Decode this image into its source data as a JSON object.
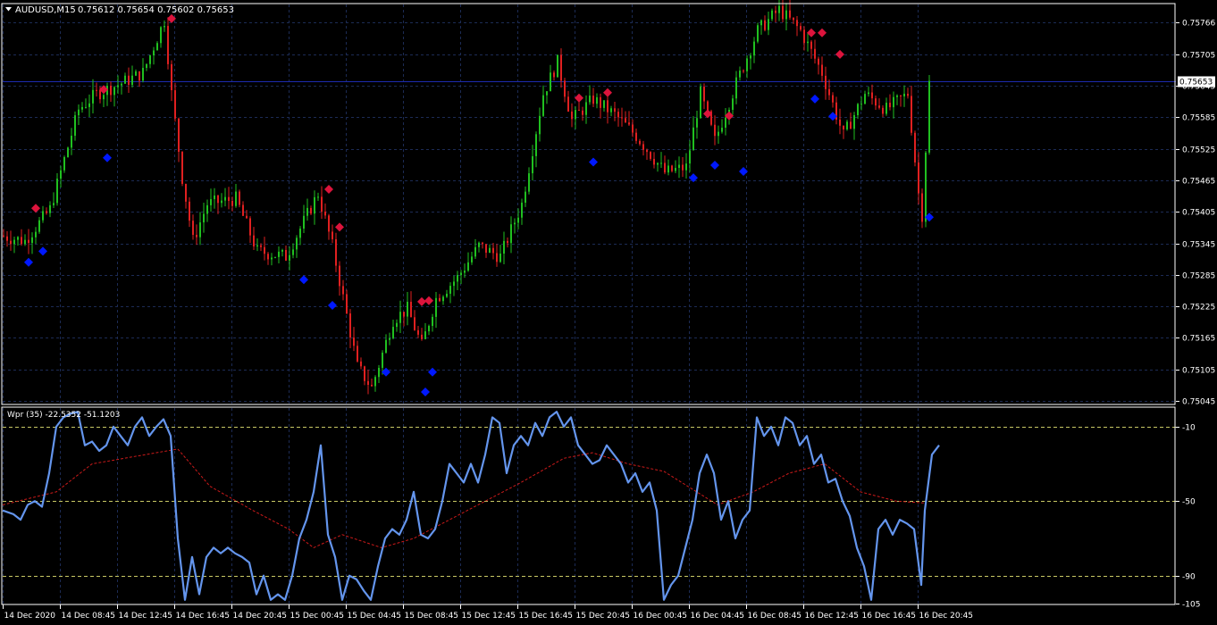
{
  "window": {
    "title": "AUDUSD,M15",
    "ohlc": "0.75612 0.75654 0.75602 0.75653",
    "menu_icon": "triangle-down-icon"
  },
  "colors": {
    "background": "#000000",
    "grid": "#1c2b55",
    "frame": "#ffffff",
    "bull": "#20c020",
    "bear": "#e02020",
    "sell_signal": "#dc143c",
    "buy_signal": "#0018ff",
    "wpr_line": "#6495ed",
    "wpr_signal": "#cc1a1a",
    "level_line": "#c8c864",
    "bid_line": "#1c2bb0"
  },
  "chart_data": [
    {
      "type": "line",
      "title": "AUDUSD,M15",
      "ylim": [
        0.7504,
        0.758
      ],
      "y_ticks": [
        0.75766,
        0.75705,
        0.75645,
        0.75585,
        0.75525,
        0.75465,
        0.75405,
        0.75345,
        0.75285,
        0.75225,
        0.75165,
        0.75105,
        0.75045
      ],
      "y_tick_labels": [
        "0.75766",
        "0.75705",
        "0.75645",
        "0.75585",
        "0.75525",
        "0.75465",
        "0.75405",
        "0.75345",
        "0.75285",
        "0.75225",
        "0.75165",
        "0.75105",
        "0.75045"
      ],
      "current_price": 0.75653,
      "current_price_label": "0.75653",
      "x_labels": [
        "14 Dec 2020",
        "14 Dec 08:45",
        "14 Dec 12:45",
        "14 Dec 16:45",
        "14 Dec 20:45",
        "15 Dec 00:45",
        "15 Dec 04:45",
        "15 Dec 08:45",
        "15 Dec 12:45",
        "15 Dec 16:45",
        "15 Dec 20:45",
        "16 Dec 00:45",
        "16 Dec 04:45",
        "16 Dec 08:45",
        "16 Dec 12:45",
        "16 Dec 16:45",
        "16 Dec 20:45"
      ],
      "x_label_index": [
        0,
        16,
        32,
        48,
        64,
        80,
        96,
        112,
        128,
        144,
        160,
        176,
        192,
        208,
        224,
        240,
        256
      ],
      "n_bars": 260,
      "close_path": [
        [
          0,
          0.7536
        ],
        [
          7,
          0.7535
        ],
        [
          14,
          0.7541
        ],
        [
          22,
          0.756
        ],
        [
          27,
          0.7563
        ],
        [
          34,
          0.7565
        ],
        [
          40,
          0.7567
        ],
        [
          46,
          0.7577
        ],
        [
          48,
          0.7563
        ],
        [
          51,
          0.7547
        ],
        [
          54,
          0.7535
        ],
        [
          58,
          0.7542
        ],
        [
          66,
          0.7543
        ],
        [
          72,
          0.7533
        ],
        [
          80,
          0.7532
        ],
        [
          89,
          0.7544
        ],
        [
          93,
          0.7534
        ],
        [
          100,
          0.7511
        ],
        [
          104,
          0.7507
        ],
        [
          110,
          0.752
        ],
        [
          114,
          0.7522
        ],
        [
          118,
          0.7515
        ],
        [
          122,
          0.7524
        ],
        [
          128,
          0.7528
        ],
        [
          134,
          0.7534
        ],
        [
          140,
          0.7532
        ],
        [
          146,
          0.7542
        ],
        [
          152,
          0.7563
        ],
        [
          156,
          0.7569
        ],
        [
          160,
          0.7558
        ],
        [
          166,
          0.7562
        ],
        [
          172,
          0.7559
        ],
        [
          178,
          0.7555
        ],
        [
          186,
          0.7548
        ],
        [
          192,
          0.7549
        ],
        [
          196,
          0.7563
        ],
        [
          200,
          0.7554
        ],
        [
          206,
          0.7565
        ],
        [
          212,
          0.7575
        ],
        [
          218,
          0.7579
        ],
        [
          224,
          0.7575
        ],
        [
          230,
          0.7567
        ],
        [
          236,
          0.7555
        ],
        [
          242,
          0.7563
        ],
        [
          248,
          0.756
        ],
        [
          254,
          0.7563
        ],
        [
          257,
          0.7544
        ],
        [
          258,
          0.754
        ],
        [
          260,
          0.7565
        ]
      ],
      "sell_signals": [
        {
          "i": 9,
          "price": 0.75412
        },
        {
          "i": 28,
          "price": 0.75638
        },
        {
          "i": 47,
          "price": 0.75773
        },
        {
          "i": 91,
          "price": 0.75448
        },
        {
          "i": 94,
          "price": 0.75376
        },
        {
          "i": 117,
          "price": 0.75234
        },
        {
          "i": 119,
          "price": 0.75236
        },
        {
          "i": 161,
          "price": 0.75622
        },
        {
          "i": 169,
          "price": 0.75632
        },
        {
          "i": 197,
          "price": 0.75592
        },
        {
          "i": 203,
          "price": 0.75588
        },
        {
          "i": 226,
          "price": 0.75746
        },
        {
          "i": 229,
          "price": 0.75746
        },
        {
          "i": 234,
          "price": 0.75705
        }
      ],
      "buy_signals": [
        {
          "i": 7,
          "price": 0.75309
        },
        {
          "i": 11,
          "price": 0.7533
        },
        {
          "i": 29,
          "price": 0.75508
        },
        {
          "i": 84,
          "price": 0.75276
        },
        {
          "i": 92,
          "price": 0.75227
        },
        {
          "i": 107,
          "price": 0.751
        },
        {
          "i": 118,
          "price": 0.75062
        },
        {
          "i": 120,
          "price": 0.751
        },
        {
          "i": 165,
          "price": 0.755
        },
        {
          "i": 193,
          "price": 0.7547
        },
        {
          "i": 199,
          "price": 0.75494
        },
        {
          "i": 207,
          "price": 0.75482
        },
        {
          "i": 227,
          "price": 0.7562
        },
        {
          "i": 232,
          "price": 0.75587
        },
        {
          "i": 259,
          "price": 0.75395
        }
      ]
    },
    {
      "type": "line",
      "title": "Wpr (35) -22.5352 -51.1203",
      "ylim": [
        -105,
        0
      ],
      "y_ticks": [
        -10,
        -50,
        -90,
        -105
      ],
      "y_tick_labels": [
        "-10",
        "-50",
        "-90",
        "-105"
      ],
      "levels": [
        -10,
        -50,
        -90
      ],
      "series": [
        {
          "role": "wpr",
          "points": [
            [
              0,
              -55
            ],
            [
              3,
              -57
            ],
            [
              5,
              -60
            ],
            [
              7,
              -52
            ],
            [
              9,
              -50
            ],
            [
              11,
              -53
            ],
            [
              13,
              -35
            ],
            [
              15,
              -10
            ],
            [
              17,
              -5
            ],
            [
              19,
              -3
            ],
            [
              21,
              -2
            ],
            [
              23,
              -20
            ],
            [
              25,
              -18
            ],
            [
              27,
              -23
            ],
            [
              29,
              -20
            ],
            [
              31,
              -10
            ],
            [
              33,
              -15
            ],
            [
              35,
              -20
            ],
            [
              37,
              -10
            ],
            [
              39,
              -5
            ],
            [
              41,
              -15
            ],
            [
              43,
              -10
            ],
            [
              45,
              -6
            ],
            [
              47,
              -15
            ],
            [
              49,
              -70
            ],
            [
              51,
              -103
            ],
            [
              53,
              -80
            ],
            [
              55,
              -100
            ],
            [
              57,
              -80
            ],
            [
              59,
              -75
            ],
            [
              61,
              -78
            ],
            [
              63,
              -75
            ],
            [
              65,
              -78
            ],
            [
              67,
              -80
            ],
            [
              69,
              -83
            ],
            [
              71,
              -100
            ],
            [
              73,
              -90
            ],
            [
              75,
              -103
            ],
            [
              77,
              -100
            ],
            [
              79,
              -103
            ],
            [
              81,
              -90
            ],
            [
              83,
              -70
            ],
            [
              85,
              -60
            ],
            [
              87,
              -45
            ],
            [
              89,
              -20
            ],
            [
              91,
              -68
            ],
            [
              93,
              -80
            ],
            [
              95,
              -103
            ],
            [
              97,
              -90
            ],
            [
              99,
              -92
            ],
            [
              101,
              -98
            ],
            [
              103,
              -103
            ],
            [
              105,
              -85
            ],
            [
              107,
              -70
            ],
            [
              109,
              -65
            ],
            [
              111,
              -68
            ],
            [
              113,
              -60
            ],
            [
              115,
              -45
            ],
            [
              117,
              -68
            ],
            [
              119,
              -70
            ],
            [
              121,
              -65
            ],
            [
              123,
              -50
            ],
            [
              125,
              -30
            ],
            [
              127,
              -35
            ],
            [
              129,
              -40
            ],
            [
              131,
              -30
            ],
            [
              133,
              -40
            ],
            [
              135,
              -25
            ],
            [
              137,
              -5
            ],
            [
              139,
              -8
            ],
            [
              141,
              -35
            ],
            [
              143,
              -20
            ],
            [
              145,
              -15
            ],
            [
              147,
              -20
            ],
            [
              149,
              -8
            ],
            [
              151,
              -15
            ],
            [
              153,
              -5
            ],
            [
              155,
              -2
            ],
            [
              157,
              -10
            ],
            [
              159,
              -5
            ],
            [
              161,
              -20
            ],
            [
              163,
              -25
            ],
            [
              165,
              -30
            ],
            [
              167,
              -28
            ],
            [
              169,
              -20
            ],
            [
              171,
              -25
            ],
            [
              173,
              -30
            ],
            [
              175,
              -40
            ],
            [
              177,
              -35
            ],
            [
              179,
              -45
            ],
            [
              181,
              -40
            ],
            [
              183,
              -55
            ],
            [
              185,
              -103
            ],
            [
              187,
              -95
            ],
            [
              189,
              -90
            ],
            [
              191,
              -75
            ],
            [
              193,
              -60
            ],
            [
              195,
              -35
            ],
            [
              197,
              -25
            ],
            [
              199,
              -35
            ],
            [
              201,
              -60
            ],
            [
              203,
              -50
            ],
            [
              205,
              -70
            ],
            [
              207,
              -60
            ],
            [
              209,
              -55
            ],
            [
              211,
              -5
            ],
            [
              213,
              -15
            ],
            [
              215,
              -10
            ],
            [
              217,
              -20
            ],
            [
              219,
              -5
            ],
            [
              221,
              -8
            ],
            [
              223,
              -20
            ],
            [
              225,
              -15
            ],
            [
              227,
              -30
            ],
            [
              229,
              -25
            ],
            [
              231,
              -40
            ],
            [
              233,
              -38
            ],
            [
              235,
              -50
            ],
            [
              237,
              -58
            ],
            [
              239,
              -75
            ],
            [
              241,
              -85
            ],
            [
              243,
              -103
            ],
            [
              245,
              -65
            ],
            [
              247,
              -60
            ],
            [
              249,
              -68
            ],
            [
              251,
              -60
            ],
            [
              253,
              -62
            ],
            [
              255,
              -65
            ],
            [
              257,
              -95
            ],
            [
              258,
              -55
            ],
            [
              260,
              -25
            ],
            [
              262,
              -20
            ]
          ]
        },
        {
          "role": "signal",
          "points": [
            [
              0,
              -52
            ],
            [
              15,
              -45
            ],
            [
              25,
              -30
            ],
            [
              40,
              -25
            ],
            [
              49,
              -22
            ],
            [
              58,
              -42
            ],
            [
              70,
              -55
            ],
            [
              80,
              -65
            ],
            [
              87,
              -75
            ],
            [
              95,
              -68
            ],
            [
              106,
              -75
            ],
            [
              115,
              -70
            ],
            [
              125,
              -60
            ],
            [
              135,
              -50
            ],
            [
              145,
              -40
            ],
            [
              157,
              -27
            ],
            [
              165,
              -24
            ],
            [
              175,
              -30
            ],
            [
              185,
              -34
            ],
            [
              200,
              -52
            ],
            [
              210,
              -45
            ],
            [
              220,
              -35
            ],
            [
              230,
              -30
            ],
            [
              240,
              -45
            ],
            [
              250,
              -50
            ],
            [
              258,
              -51
            ]
          ]
        }
      ]
    }
  ]
}
